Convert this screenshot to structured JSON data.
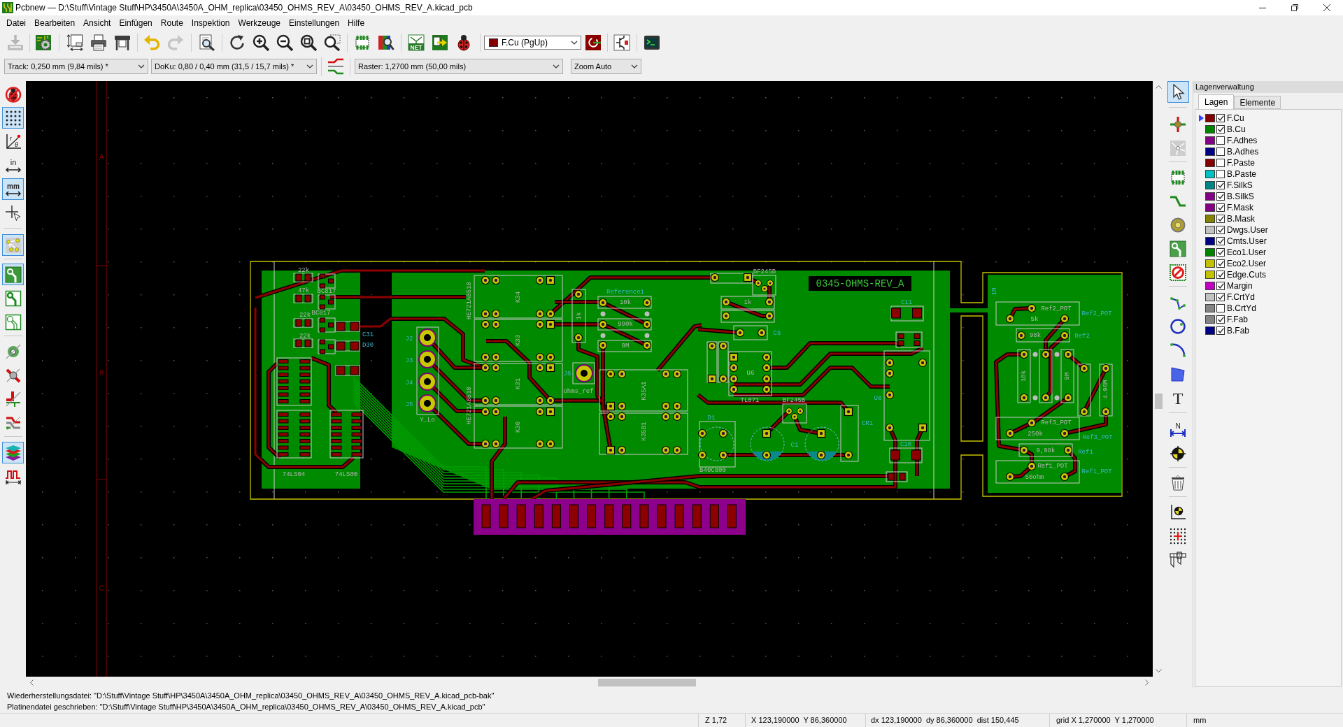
{
  "window": {
    "title": "Pcbnew — D:\\Stuff\\Vintage Stuff\\HP\\3450A\\3450A_OHM_replica\\03450_OHMS_REV_A\\03450_OHMS_REV_A.kicad_pcb"
  },
  "menu": [
    "Datei",
    "Bearbeiten",
    "Ansicht",
    "Einfügen",
    "Route",
    "Inspektion",
    "Werkzeuge",
    "Einstellungen",
    "Hilfe"
  ],
  "main_toolbar": [
    {
      "disabled": true
    },
    {
      "disabled": false
    },
    {
      "disabled": false
    },
    {
      "disabled": false
    },
    {
      "disabled": false
    },
    {
      "disabled": false
    },
    {
      "disabled": true
    },
    {
      "disabled": false
    },
    {
      "disabled": false
    },
    {
      "disabled": false
    },
    {
      "disabled": false
    },
    {
      "disabled": false
    },
    {
      "disabled": false
    },
    {
      "disabled": false
    },
    {
      "disabled": false
    },
    {
      "disabled": false,
      "label": "NET"
    },
    {
      "disabled": false
    },
    {
      "disabled": false
    },
    {
      "disabled": false
    },
    {
      "disabled": false
    },
    {
      "disabled": false
    }
  ],
  "layer_select": {
    "value": "F.Cu (PgUp)",
    "color": "#840000"
  },
  "options_toolbar": {
    "track": "Track: 0,250 mm (9,84 mils) *",
    "via": "DoKu: 0,80 / 0,40 mm (31,5 / 15,7 mils) *",
    "grid": "Raster: 1,2700 mm (50,00 mils)",
    "zoom": "Zoom Auto"
  },
  "left_toolbar": [
    {
      "selected": false
    },
    {
      "selected": true
    },
    {
      "selected": false,
      "letters": [
        "r",
        "θ"
      ]
    },
    {
      "selected": false,
      "label": "in"
    },
    {
      "selected": true,
      "label": "mm"
    },
    {
      "selected": false
    },
    {
      "selected": true
    },
    {
      "selected": true
    },
    {
      "selected": false
    },
    {
      "selected": false
    },
    {
      "selected": false
    },
    {
      "selected": false
    },
    {
      "selected": false
    },
    {
      "selected": false
    },
    {
      "selected": true
    },
    {
      "selected": false
    }
  ],
  "canvas": {
    "sheet_zone_labels": [
      "A",
      "B",
      "C"
    ],
    "board": {
      "title": "0345-OHMS-REV_A",
      "labels": [
        {
          "text": "22k",
          "kind": "fab"
        },
        {
          "text": "47k",
          "kind": "fab"
        },
        {
          "text": "22k",
          "kind": "fab"
        },
        {
          "text": "22k",
          "kind": "fab"
        },
        {
          "text": "BC817",
          "kind": "fab"
        },
        {
          "text": "BC817",
          "kind": "fab"
        },
        {
          "text": "C31",
          "kind": "silk"
        },
        {
          "text": "D30",
          "kind": "silk"
        },
        {
          "text": "74LS04",
          "kind": "fab"
        },
        {
          "text": "74LS00",
          "kind": "fab"
        },
        {
          "text": "J2",
          "kind": "silk"
        },
        {
          "text": "J3",
          "kind": "silk"
        },
        {
          "text": "J4",
          "kind": "silk"
        },
        {
          "text": "J5",
          "kind": "silk"
        },
        {
          "text": "Y_Lo",
          "kind": "fab"
        },
        {
          "text": "K34",
          "kind": "fab"
        },
        {
          "text": "K33",
          "kind": "fab"
        },
        {
          "text": "K31",
          "kind": "fab"
        },
        {
          "text": "K30",
          "kind": "fab"
        },
        {
          "text": "HE721A0510",
          "kind": "fab"
        },
        {
          "text": "HE721A0510",
          "kind": "fab"
        },
        {
          "text": "1k",
          "kind": "fab"
        },
        {
          "text": "Reference1",
          "kind": "silk"
        },
        {
          "text": "10k",
          "kind": "fab"
        },
        {
          "text": "990k",
          "kind": "fab"
        },
        {
          "text": "9M",
          "kind": "fab"
        },
        {
          "text": "J6",
          "kind": "silk"
        },
        {
          "text": "ohms_ref",
          "kind": "fab"
        },
        {
          "text": "K35A1",
          "kind": "fab"
        },
        {
          "text": "K35B1",
          "kind": "fab"
        },
        {
          "text": "BF245B",
          "kind": "fab"
        },
        {
          "text": "1k",
          "kind": "fab"
        },
        {
          "text": "C6",
          "kind": "silk"
        },
        {
          "text": "U6",
          "kind": "fab"
        },
        {
          "text": "TL071",
          "kind": "fab"
        },
        {
          "text": "BF245B",
          "kind": "fab"
        },
        {
          "text": "CR1",
          "kind": "silk"
        },
        {
          "text": "D1",
          "kind": "silk"
        },
        {
          "text": "C1",
          "kind": "silk"
        },
        {
          "text": "B40C800",
          "kind": "fab"
        },
        {
          "text": "C11",
          "kind": "silk"
        },
        {
          "text": "U8",
          "kind": "silk"
        },
        {
          "text": "C10",
          "kind": "silk"
        },
        {
          "text": "Ref2_POT",
          "kind": "fab"
        },
        {
          "text": "Ref2_POT",
          "kind": "silk"
        },
        {
          "text": "5k",
          "kind": "fab"
        },
        {
          "text": "98k",
          "kind": "fab"
        },
        {
          "text": "Ref2",
          "kind": "silk"
        },
        {
          "text": "10k",
          "kind": "fab"
        },
        {
          "text": "9M",
          "kind": "fab"
        },
        {
          "text": "4.96M",
          "kind": "fab"
        },
        {
          "text": "Ref3_POT",
          "kind": "fab"
        },
        {
          "text": "Ref3_POT",
          "kind": "silk"
        },
        {
          "text": "250k",
          "kind": "fab"
        },
        {
          "text": "9,98k",
          "kind": "fab"
        },
        {
          "text": "Ref1",
          "kind": "silk"
        },
        {
          "text": "Ref1_POT",
          "kind": "fab"
        },
        {
          "text": "Ref1_POT",
          "kind": "silk"
        },
        {
          "text": "50ohm",
          "kind": "fab"
        },
        {
          "text": "1M",
          "kind": "silk"
        }
      ]
    }
  },
  "right_toolbar": [
    {
      "selected": true
    },
    {
      "selected": false
    },
    {
      "selected": false
    },
    {
      "selected": false
    },
    {
      "selected": false
    },
    {
      "selected": false
    },
    {
      "selected": false
    },
    {
      "selected": false
    },
    {
      "selected": false
    },
    {
      "selected": false
    },
    {
      "selected": false
    },
    {
      "selected": false
    },
    {
      "selected": false,
      "label": "T"
    },
    {
      "selected": false,
      "label": "N"
    },
    {
      "selected": false
    },
    {
      "selected": false
    },
    {
      "selected": false
    },
    {
      "selected": false
    },
    {
      "selected": false
    }
  ],
  "layers_panel": {
    "title": "Lagenverwaltung",
    "tabs": [
      {
        "label": "Lagen",
        "selected": true
      },
      {
        "label": "Elemente",
        "selected": false
      }
    ],
    "layers": [
      {
        "name": "F.Cu",
        "color": "#840000",
        "visible": true,
        "selected": true
      },
      {
        "name": "B.Cu",
        "color": "#008400",
        "visible": true,
        "selected": false
      },
      {
        "name": "F.Adhes",
        "color": "#840084",
        "visible": false,
        "selected": false
      },
      {
        "name": "B.Adhes",
        "color": "#000084",
        "visible": false,
        "selected": false
      },
      {
        "name": "F.Paste",
        "color": "#840000",
        "visible": false,
        "selected": false
      },
      {
        "name": "B.Paste",
        "color": "#00c2c2",
        "visible": false,
        "selected": false
      },
      {
        "name": "F.SilkS",
        "color": "#008484",
        "visible": true,
        "selected": false
      },
      {
        "name": "B.SilkS",
        "color": "#840084",
        "visible": true,
        "selected": false
      },
      {
        "name": "F.Mask",
        "color": "#840084",
        "visible": true,
        "selected": false
      },
      {
        "name": "B.Mask",
        "color": "#848400",
        "visible": true,
        "selected": false
      },
      {
        "name": "Dwgs.User",
        "color": "#c2c2c2",
        "visible": true,
        "selected": false
      },
      {
        "name": "Cmts.User",
        "color": "#000084",
        "visible": true,
        "selected": false
      },
      {
        "name": "Eco1.User",
        "color": "#008400",
        "visible": true,
        "selected": false
      },
      {
        "name": "Eco2.User",
        "color": "#c2c200",
        "visible": true,
        "selected": false
      },
      {
        "name": "Edge.Cuts",
        "color": "#c2c200",
        "visible": true,
        "selected": false
      },
      {
        "name": "Margin",
        "color": "#c200c2",
        "visible": true,
        "selected": false
      },
      {
        "name": "F.CrtYd",
        "color": "#c2c2c2",
        "visible": true,
        "selected": false
      },
      {
        "name": "B.CrtYd",
        "color": "#848484",
        "visible": false,
        "selected": false
      },
      {
        "name": "F.Fab",
        "color": "#848484",
        "visible": true,
        "selected": false
      },
      {
        "name": "B.Fab",
        "color": "#000084",
        "visible": true,
        "selected": false
      }
    ]
  },
  "messages": [
    "Wiederherstellungsdatei: \"D:\\Stuff\\Vintage Stuff\\HP\\3450A\\3450A_OHM_replica\\03450_OHMS_REV_A\\03450_OHMS_REV_A.kicad_pcb-bak\"",
    "Platinendatei geschrieben: \"D:\\Stuff\\Vintage Stuff\\HP\\3450A\\3450A_OHM_replica\\03450_OHMS_REV_A\\03450_OHMS_REV_A.kicad_pcb\""
  ],
  "status_bar": {
    "zoom": "Z 1,72",
    "position": "X 123,190000  Y 86,360000",
    "delta": "dx 123,190000  dy 86,360000  dist 150,445",
    "grid": "grid X 1,270000  Y 1,270000",
    "units": "mm"
  }
}
